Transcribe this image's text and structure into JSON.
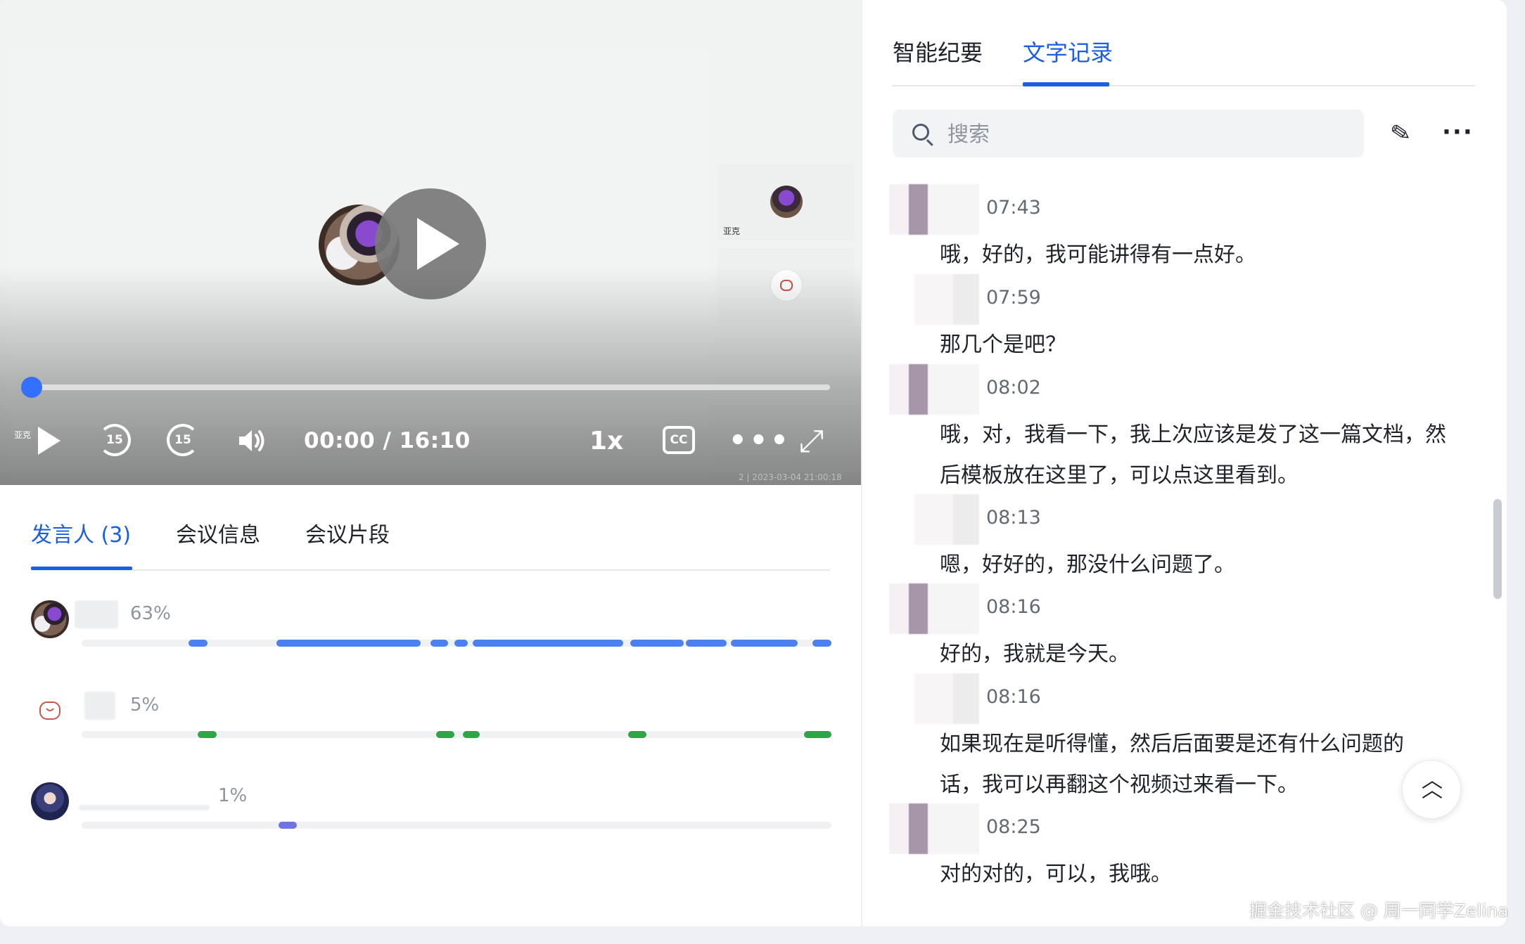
{
  "video": {
    "thumb1_label": "亚克",
    "corner_label": "亚克",
    "watermark": "2 | 2023-03-04 21:00:18",
    "time": "00:00 / 16:10",
    "played_fraction": 0.0,
    "speed": "1x",
    "cc": "CC",
    "skip_back": "15",
    "skip_forward": "15",
    "more": "•••",
    "fullscreen": "⤢"
  },
  "left_tabs": {
    "speakers": "发言人 (3)",
    "meeting_info": "会议信息",
    "clips": "会议片段"
  },
  "speakers": [
    {
      "pct": "63%",
      "color": "#4a80f0",
      "segments": [
        [
          0.143,
          0.168
        ],
        [
          0.26,
          0.452
        ],
        [
          0.465,
          0.489
        ],
        [
          0.497,
          0.515
        ],
        [
          0.522,
          0.722
        ],
        [
          0.732,
          0.803
        ],
        [
          0.806,
          0.86
        ],
        [
          0.866,
          0.955
        ],
        [
          0.975,
          1.0
        ]
      ]
    },
    {
      "pct": "5%",
      "color": "#2fa646",
      "segments": [
        [
          0.155,
          0.18
        ],
        [
          0.473,
          0.497
        ],
        [
          0.508,
          0.531
        ],
        [
          0.729,
          0.753
        ],
        [
          0.963,
          1.0
        ]
      ]
    },
    {
      "pct": "1%",
      "color": "#6f74e0",
      "segments": [
        [
          0.263,
          0.287
        ]
      ]
    }
  ],
  "right_tabs": {
    "summary": "智能纪要",
    "transcript": "文字记录"
  },
  "search": {
    "placeholder": "搜索"
  },
  "icons": {
    "edit": "pencil-icon",
    "more": "more-horizontal-icon",
    "back_top": "chevrons-up-icon"
  },
  "transcript": [
    {
      "time": "07:43",
      "text": "哦，好的，我可能讲得有一点好。"
    },
    {
      "time": "07:59",
      "text": "那几个是吧？"
    },
    {
      "time": "08:02",
      "text": "哦，对，我看一下，我上次应该是发了这一篇文档，然后模板放在这里了，可以点这里看到。"
    },
    {
      "time": "08:13",
      "text": "嗯，好好的，那没什么问题了。"
    },
    {
      "time": "08:16",
      "text": "好的，我就是今天。"
    },
    {
      "time": "08:16",
      "text": "如果现在是听得懂，然后后面要是还有什么问题的话，我可以再翻这个视频过来看一下。"
    },
    {
      "time": "08:25",
      "text": "对的对的，可以，我哦。"
    }
  ],
  "footer_watermark": "掘金技术社区 @ 周一同学Zelina"
}
